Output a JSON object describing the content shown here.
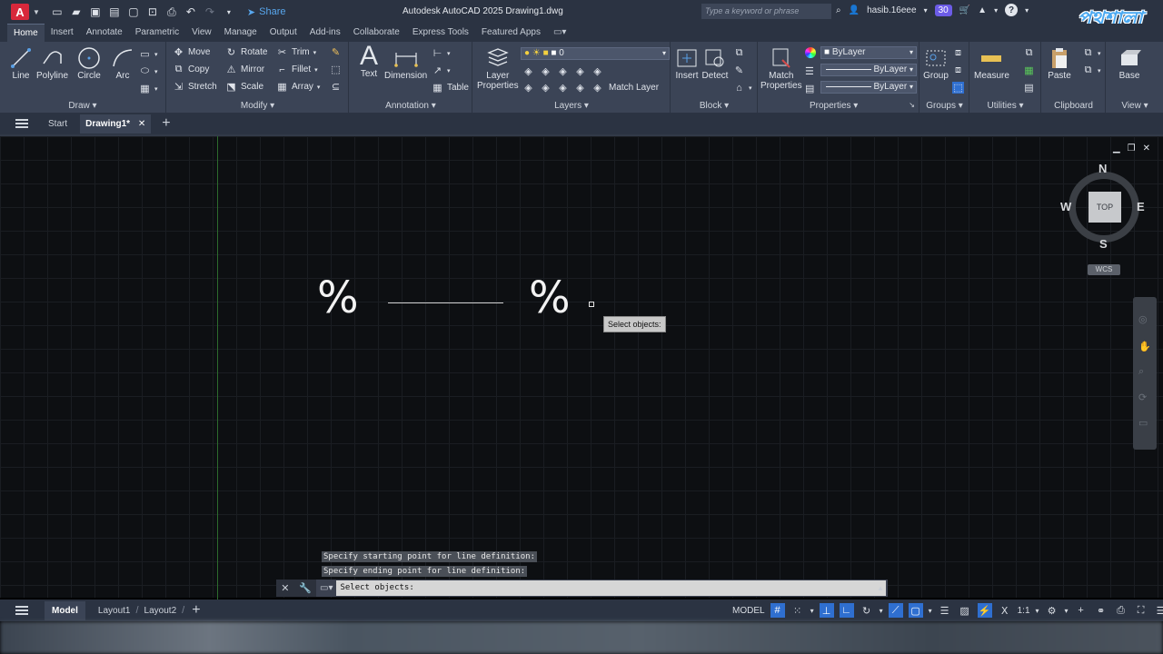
{
  "titlebar": {
    "app_icon_letter": "A",
    "share_label": "Share",
    "title": "Autodesk AutoCAD 2025    Drawing1.dwg",
    "search_placeholder": "Type a keyword or phrase",
    "user": "hasib.16eee",
    "badge": "30",
    "help": "?",
    "watermark": "পথশালা"
  },
  "ribbon_tabs": [
    "Home",
    "Insert",
    "Annotate",
    "Parametric",
    "View",
    "Manage",
    "Output",
    "Add-ins",
    "Collaborate",
    "Express Tools",
    "Featured Apps"
  ],
  "ribbon": {
    "draw": {
      "label": "Draw",
      "line": "Line",
      "polyline": "Polyline",
      "circle": "Circle",
      "arc": "Arc"
    },
    "modify": {
      "label": "Modify",
      "move": "Move",
      "rotate": "Rotate",
      "trim": "Trim",
      "copy": "Copy",
      "mirror": "Mirror",
      "fillet": "Fillet",
      "stretch": "Stretch",
      "scale": "Scale",
      "array": "Array"
    },
    "annotation": {
      "label": "Annotation",
      "text": "Text",
      "dimension": "Dimension",
      "table": "Table"
    },
    "layers": {
      "label": "Layers",
      "layer_properties_1": "Layer",
      "layer_properties_2": "Properties",
      "current_layer": "0",
      "match_layer": "Match Layer"
    },
    "block": {
      "label": "Block",
      "insert": "Insert",
      "detect": "Detect"
    },
    "properties": {
      "label": "Properties",
      "match_1": "Match",
      "match_2": "Properties",
      "color": "ByLayer",
      "linetype": "ByLayer",
      "lineweight": "ByLayer"
    },
    "groups": {
      "label": "Groups",
      "group": "Group"
    },
    "utilities": {
      "label": "Utilities",
      "measure": "Measure"
    },
    "clipboard": {
      "label": "Clipboard",
      "paste": "Paste"
    },
    "view": {
      "label": "View",
      "base": "Base"
    }
  },
  "doc_tabs": {
    "start": "Start",
    "active": "Drawing1*"
  },
  "drawing": {
    "percent_left": "%",
    "percent_right": "%",
    "tooltip": "Select objects:"
  },
  "viewcube": {
    "n": "N",
    "s": "S",
    "e": "E",
    "w": "W",
    "top": "TOP",
    "wcs": "WCS"
  },
  "command": {
    "history": [
      "Specify starting point for line definition:",
      "Specify ending point for line definition:"
    ],
    "prompt": "Select objects:"
  },
  "statusbar": {
    "tabs": [
      "Model",
      "Layout1",
      "Layout2"
    ],
    "model": "MODEL",
    "scale": "1:1"
  },
  "colors": {
    "accent": "#2f6fd0",
    "brand": "#d8283b",
    "background": "#0d0f12"
  }
}
